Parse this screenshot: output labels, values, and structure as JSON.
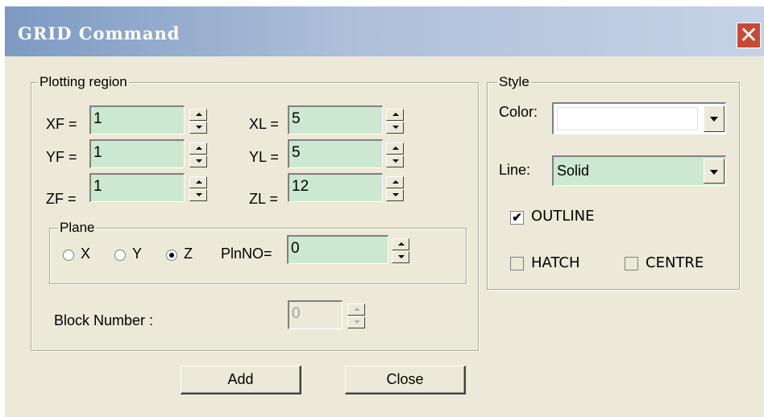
{
  "window": {
    "title": "GRID Command",
    "close_label": "✕"
  },
  "plotting_region": {
    "label": "Plotting region",
    "fields": [
      {
        "label": "XF =",
        "value": "1"
      },
      {
        "label": "YF =",
        "value": "1"
      },
      {
        "label": "ZF =",
        "value": "1"
      },
      {
        "label": "XL =",
        "value": "5"
      },
      {
        "label": "YL =",
        "value": "5"
      },
      {
        "label": "ZL =",
        "value": "12"
      }
    ],
    "plane": {
      "label": "Plane",
      "options": [
        "X",
        "Y",
        "Z"
      ],
      "selected": "Z",
      "plnno_label": "PlnNO=",
      "plnno_value": "0"
    },
    "block_number": {
      "label": "Block Number :",
      "value": "0"
    }
  },
  "style": {
    "label": "Style",
    "color_label": "Color:",
    "color_value": "#ffffff",
    "line_label": "Line:",
    "line_value": "Solid",
    "checkboxes": [
      {
        "label": "OUTLINE",
        "checked": true
      },
      {
        "label": "HATCH",
        "checked": false
      },
      {
        "label": "CENTRE",
        "checked": false
      }
    ]
  },
  "buttons": {
    "add": "Add",
    "close": "Close"
  },
  "colors": {
    "field_bg": "#cce8d0",
    "dialog_bg": "#ece9d8",
    "close_btn": "#c84a34"
  }
}
